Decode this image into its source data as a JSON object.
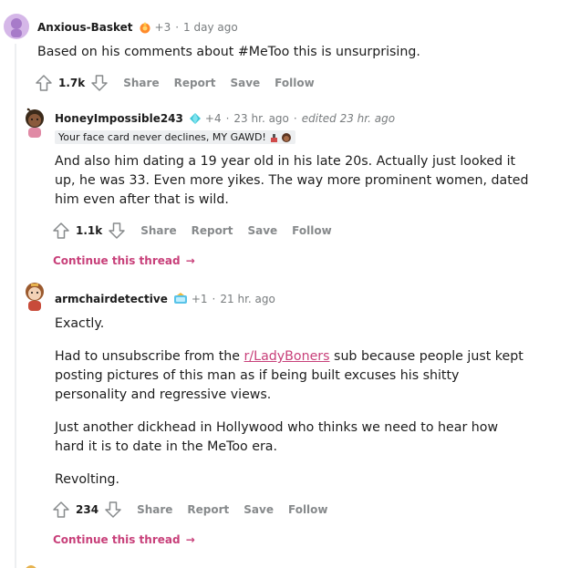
{
  "comments": [
    {
      "username": "Anxious-Basket",
      "award_count": "+3",
      "time": "1 day ago",
      "body": [
        "Based on his comments about #MeToo this is unsurprising."
      ],
      "votes": "1.7k"
    },
    {
      "username": "HoneyImpossible243",
      "award_count": "+4",
      "time": "23 hr. ago",
      "edited": "edited 23 hr. ago",
      "flair": "Your face card never declines, MY GAWD!",
      "body": [
        "And also him dating a 19 year old in his late 20s. Actually just looked it up, he was 33. Even more yikes. The way more prominent women, dated him even after that is wild."
      ],
      "votes": "1.1k"
    },
    {
      "username": "armchairdetective",
      "award_count": "+1",
      "time": "21 hr. ago",
      "body": [
        "Exactly.",
        "sub because people just kept posting pictures of this man as if being built excuses his shitty personality and regressive views.",
        "Just another dickhead in Hollywood who thinks we need to hear how hard it is to date in the MeToo era.",
        "Revolting."
      ],
      "body_prefix": "Had to unsubscribe from the",
      "subreddit_link": "r/LadyBoners",
      "votes": "234"
    }
  ],
  "actions": {
    "share": "Share",
    "report": "Report",
    "save": "Save",
    "follow": "Follow"
  },
  "continue_label": "Continue this thread",
  "colors": {
    "accent": "#c8407a",
    "meta": "#787c7e",
    "thread_line": "#edeff1"
  }
}
